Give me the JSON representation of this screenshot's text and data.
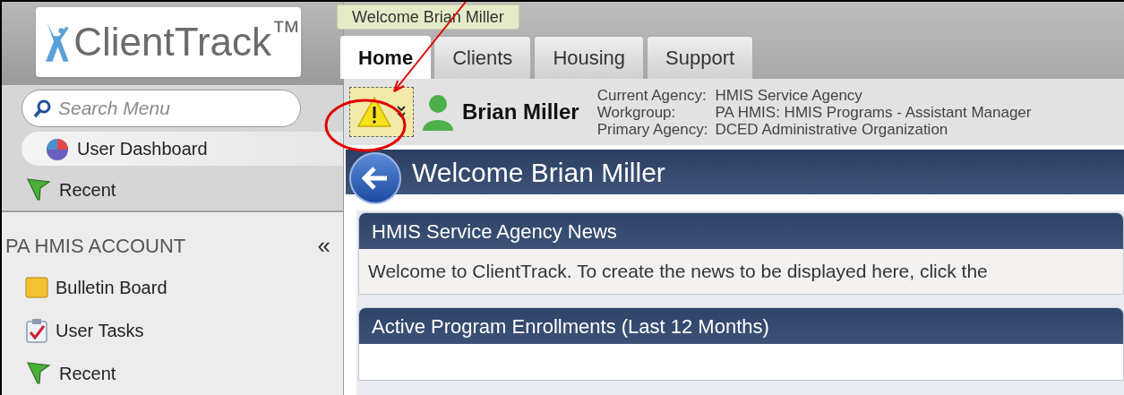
{
  "header": {
    "logo": "ClientTrack$^{™}$",
    "welcome": "Welcome Brian Miller"
  },
  "tabs": [
    {
      "label": "Home",
      "selected": true
    },
    {
      "label": "Clients",
      "selected": false
    },
    {
      "label": "Housing",
      "selected": false
    },
    {
      "label": "Support",
      "selected": false
    }
  ],
  "search": {
    "placeholder": "Search Menu"
  },
  "quick_links": [
    {
      "label": "User Dashboard",
      "selected": true,
      "kind": "dashboard"
    },
    {
      "label": "Recent",
      "selected": false,
      "kind": "flag"
    }
  ],
  "account": {
    "title": "PA HMIS ACCOUNT",
    "collapse": "«",
    "items": [
      {
        "label": "Bulletin Board",
        "kind": "board"
      },
      {
        "label": "User Tasks",
        "kind": "tasks"
      },
      {
        "label": "Recent",
        "kind": "flag"
      }
    ]
  },
  "user": {
    "name": "Brian Miller",
    "details": [
      {
        "label": "Current Agency:",
        "value": "HMIS Service Agency"
      },
      {
        "label": "Workgroup:",
        "value": "PA HMIS: HMIS Programs - Assistant Manager"
      },
      {
        "label": "Primary Agency:",
        "value": "DCED Administrative Organization"
      }
    ]
  },
  "page_title": "Welcome Brian Miller",
  "panels": [
    {
      "title": "HMIS Service Agency News",
      "body": "Welcome to ClientTrack. To create the news to be displayed here, click the"
    },
    {
      "title": "Active Program Enrollments (Last 12 Months)"
    }
  ]
}
